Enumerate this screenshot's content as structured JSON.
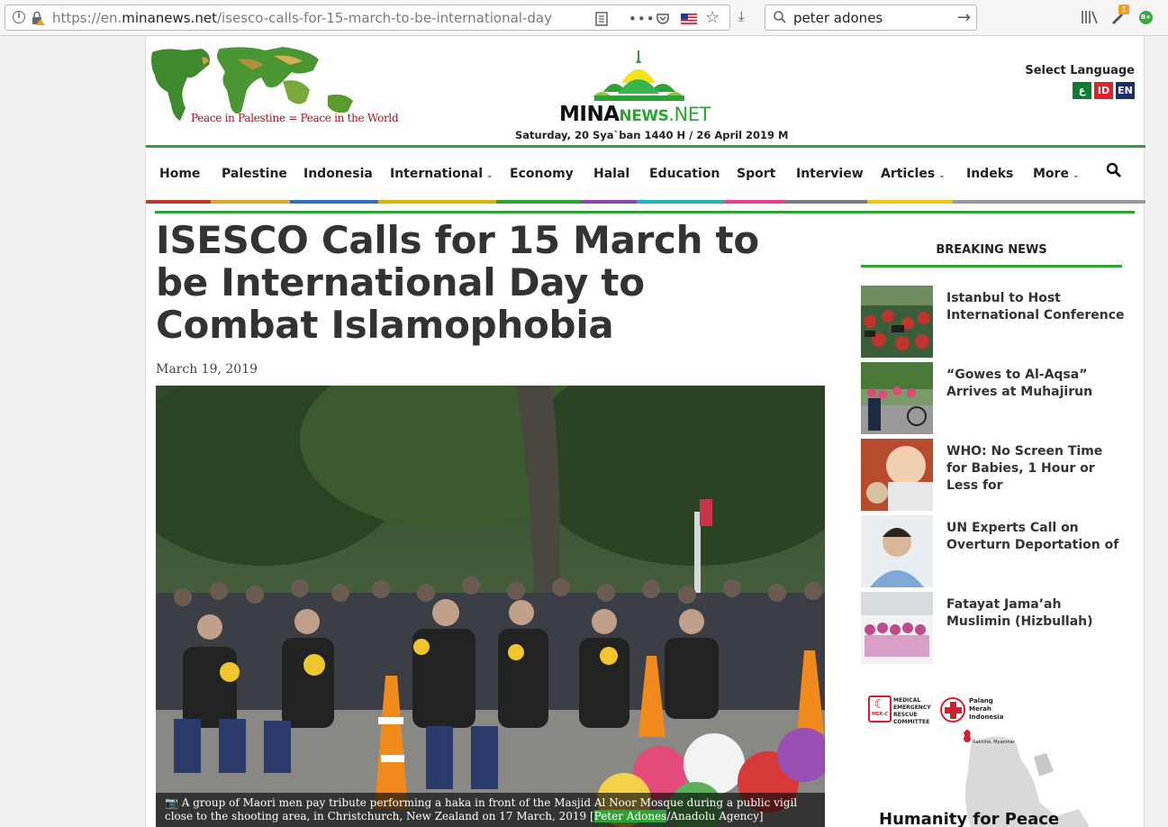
{
  "browser": {
    "url_prefix": "https://en.",
    "url_domain": "minanews.net",
    "url_path": "/isesco-calls-for-15-march-to-be-international-day",
    "search_query": "peter adones",
    "notification_count": "1",
    "addon_badge": "B+"
  },
  "header": {
    "slogan": "Peace in Palestine = Peace in the World",
    "logo_mina": "MINA",
    "logo_news": "NEWS",
    "logo_net": ".NET",
    "date": "Saturday, 20 Sya`ban 1440 H / 26 April 2019 M",
    "language_title": "Select Language",
    "languages": [
      {
        "label": "ع",
        "color": "#0d7d2f"
      },
      {
        "label": "ID",
        "color": "#e0202a"
      },
      {
        "label": "EN",
        "color": "#1f2d6b"
      }
    ]
  },
  "nav": {
    "items": [
      {
        "label": "Home"
      },
      {
        "label": "Palestine"
      },
      {
        "label": "Indonesia"
      },
      {
        "label": "International"
      },
      {
        "label": "Economy"
      },
      {
        "label": "Halal"
      },
      {
        "label": "Education"
      },
      {
        "label": "Sport"
      },
      {
        "label": "Interview"
      },
      {
        "label": "Articles"
      },
      {
        "label": "Indeks"
      },
      {
        "label": "More"
      }
    ],
    "stripe_colors": [
      "#c0392b",
      "#e6a12a",
      "#2b6fc7",
      "#d8b400",
      "#2ea236",
      "#8e44ad",
      "#1fb5b5",
      "#e84393",
      "#7a7a7a",
      "#f4c20d",
      "#999999"
    ]
  },
  "article": {
    "title": "ISESCO Calls for 15 March to be International Day to Combat Islamophobia",
    "date": "March 19, 2019",
    "caption_before": "A group of Maori men pay tribute performing a haka in front of the Masjid Al Noor Mosque during a public vigil close to the shooting area, in Christchurch, New Zealand on 17 March, 2019 [",
    "caption_credit": "Peter Adones",
    "caption_after": "/Anadolu Agency]"
  },
  "sidebar": {
    "title": "BREAKING NEWS",
    "items": [
      {
        "text": "Istanbul to Host International Conference"
      },
      {
        "text": "“Gowes to Al-Aqsa” Arrives at Muhajirun"
      },
      {
        "text": "WHO: No Screen Time for Babies, 1 Hour or Less for"
      },
      {
        "text": "UN Experts Call on Overturn Deportation of"
      },
      {
        "text": "Fatayat Jama’ah Muslimin (Hizbullah)"
      }
    ],
    "ad": {
      "org1": "MEDICAL EMERGENCY RESCUE COMMITTEE",
      "org1_short": "MER-C",
      "org2": "Palang Merah Indonesia",
      "map_label": "Rakhine, Myanmar",
      "headline": "Humanity for Peace"
    }
  }
}
